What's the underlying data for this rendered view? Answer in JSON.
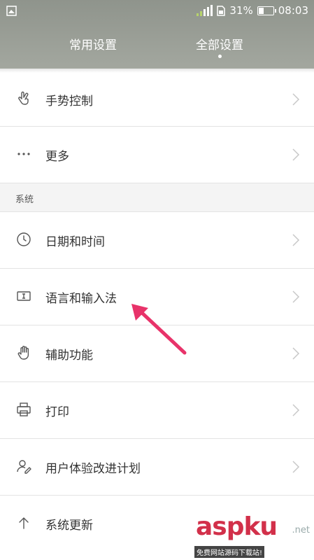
{
  "status_bar": {
    "battery_text": "31%",
    "time": "08:03",
    "battery_level": 0.31
  },
  "tabs": [
    {
      "label": "常用设置",
      "active": false
    },
    {
      "label": "全部设置",
      "active": true
    }
  ],
  "rows_top": [
    {
      "label": "手势控制",
      "icon": "gesture-hand-icon"
    },
    {
      "label": "更多",
      "icon": "more-dots-icon"
    }
  ],
  "section_system": {
    "label": "系统"
  },
  "rows_system": [
    {
      "label": "日期和时间",
      "icon": "clock-icon"
    },
    {
      "label": "语言和输入法",
      "icon": "text-input-icon"
    },
    {
      "label": "辅助功能",
      "icon": "hand-icon"
    },
    {
      "label": "打印",
      "icon": "printer-icon"
    },
    {
      "label": "用户体验改进计划",
      "icon": "user-edit-icon"
    },
    {
      "label": "系统更新",
      "icon": "arrow-up-icon"
    }
  ],
  "colors": {
    "header": "#9a9e96",
    "annotation_arrow": "#e8336a",
    "watermark": "#d2304a"
  },
  "watermark": {
    "brand": "aspku",
    "domain": ".net",
    "tagline": "免费网站源码下载站!"
  }
}
